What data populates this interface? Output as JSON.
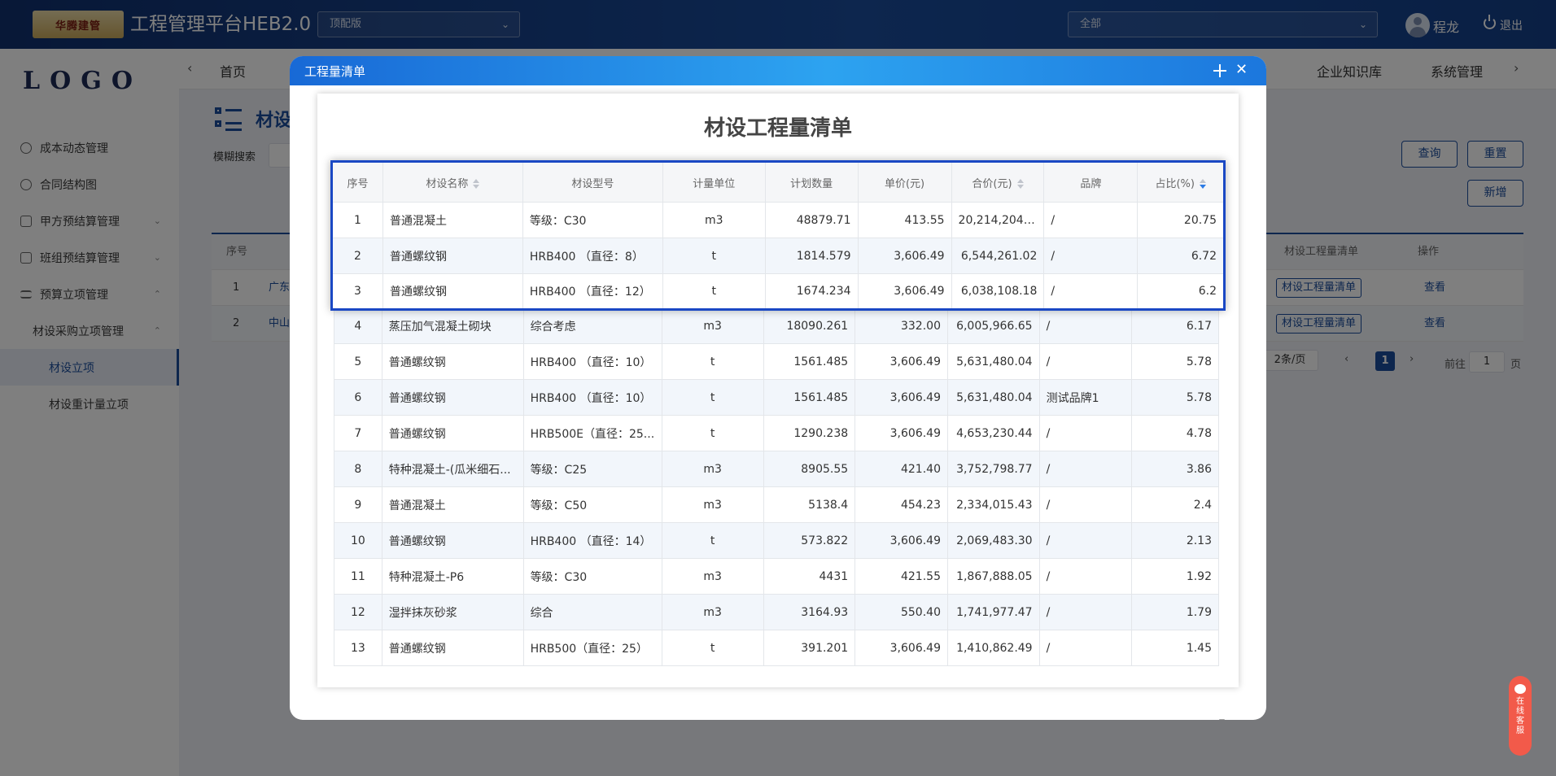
{
  "header": {
    "brand_logo_text": "华腾建管",
    "app_title": "工程管理平台HEB2.0",
    "version_select": "顶配版",
    "scope_select": "全部",
    "user_name": "程龙",
    "logout_label": "退出"
  },
  "sidebar": {
    "logo": "LOGO",
    "items": [
      {
        "label": "成本动态管理"
      },
      {
        "label": "合同结构图"
      },
      {
        "label": "甲方预结算管理"
      },
      {
        "label": "班组预结算管理"
      },
      {
        "label": "预算立项管理"
      },
      {
        "label": "材设采购立项管理"
      },
      {
        "label": "材设立项"
      },
      {
        "label": "材设重计量立项"
      }
    ]
  },
  "nav": {
    "tabs": [
      {
        "label": "首页"
      },
      {
        "label": "企业知识库"
      },
      {
        "label": "系统管理"
      }
    ]
  },
  "main": {
    "page_title": "材设",
    "fuzzy_search_label": "模糊搜索",
    "buttons": {
      "query": "查询",
      "reset": "重置",
      "add": "新增"
    },
    "table": {
      "headers": {
        "index": "序号",
        "bill": "材设工程量清单",
        "action": "操作"
      },
      "rows": [
        {
          "index": "1",
          "name": "广东",
          "bill": "材设工程量清单",
          "action": "查看"
        },
        {
          "index": "2",
          "name": "中山",
          "bill": "材设工程量清单",
          "action": "查看"
        }
      ]
    },
    "pager": {
      "page_size": "2条/页",
      "current": "1",
      "goto_prefix": "前往",
      "goto_value": "1",
      "goto_suffix": "页"
    }
  },
  "dialog": {
    "title": "工程量清单",
    "sheet_title": "材设工程量清单",
    "columns": [
      "序号",
      "材设名称",
      "材设型号",
      "计量单位",
      "计划数量",
      "单价(元)",
      "合价(元)",
      "品牌",
      "占比(%)"
    ],
    "rows": [
      {
        "no": "1",
        "name": "普通混凝土",
        "model": "等级：C30",
        "unit": "m3",
        "qty": "48879.71",
        "price": "413.55",
        "total": "20,214,204....",
        "brand": "/",
        "ratio": "20.75"
      },
      {
        "no": "2",
        "name": "普通螺纹钢",
        "model": "HRB400 （直径：8）",
        "unit": "t",
        "qty": "1814.579",
        "price": "3,606.49",
        "total": "6,544,261.02",
        "brand": "/",
        "ratio": "6.72"
      },
      {
        "no": "3",
        "name": "普通螺纹钢",
        "model": "HRB400 （直径：12）",
        "unit": "t",
        "qty": "1674.234",
        "price": "3,606.49",
        "total": "6,038,108.18",
        "brand": "/",
        "ratio": "6.2"
      },
      {
        "no": "4",
        "name": "蒸压加气混凝土砌块",
        "model": "综合考虑",
        "unit": "m3",
        "qty": "18090.261",
        "price": "332.00",
        "total": "6,005,966.65",
        "brand": "/",
        "ratio": "6.17"
      },
      {
        "no": "5",
        "name": "普通螺纹钢",
        "model": "HRB400 （直径：10）",
        "unit": "t",
        "qty": "1561.485",
        "price": "3,606.49",
        "total": "5,631,480.04",
        "brand": "/",
        "ratio": "5.78"
      },
      {
        "no": "6",
        "name": "普通螺纹钢",
        "model": "HRB400 （直径：10）",
        "unit": "t",
        "qty": "1561.485",
        "price": "3,606.49",
        "total": "5,631,480.04",
        "brand": "测试品牌1",
        "ratio": "5.78"
      },
      {
        "no": "7",
        "name": "普通螺纹钢",
        "model": "HRB500E（直径：25...",
        "unit": "t",
        "qty": "1290.238",
        "price": "3,606.49",
        "total": "4,653,230.44",
        "brand": "/",
        "ratio": "4.78"
      },
      {
        "no": "8",
        "name": "特种混凝土-(瓜米细石...",
        "model": "等级：C25",
        "unit": "m3",
        "qty": "8905.55",
        "price": "421.40",
        "total": "3,752,798.77",
        "brand": "/",
        "ratio": "3.86"
      },
      {
        "no": "9",
        "name": "普通混凝土",
        "model": "等级：C50",
        "unit": "m3",
        "qty": "5138.4",
        "price": "454.23",
        "total": "2,334,015.43",
        "brand": "/",
        "ratio": "2.4"
      },
      {
        "no": "10",
        "name": "普通螺纹钢",
        "model": "HRB400 （直径：14）",
        "unit": "t",
        "qty": "573.822",
        "price": "3,606.49",
        "total": "2,069,483.30",
        "brand": "/",
        "ratio": "2.13"
      },
      {
        "no": "11",
        "name": "特种混凝土-P6",
        "model": "等级：C30",
        "unit": "m3",
        "qty": "4431",
        "price": "421.55",
        "total": "1,867,888.05",
        "brand": "/",
        "ratio": "1.92"
      },
      {
        "no": "12",
        "name": "湿拌抹灰砂浆",
        "model": "综合",
        "unit": "m3",
        "qty": "3164.93",
        "price": "550.40",
        "total": "1,741,977.47",
        "brand": "/",
        "ratio": "1.79"
      },
      {
        "no": "13",
        "name": "普通螺纹钢",
        "model": "HRB500（直径：25）",
        "unit": "t",
        "qty": "391.201",
        "price": "3,606.49",
        "total": "1,410,862.49",
        "brand": "/",
        "ratio": "1.45"
      }
    ]
  },
  "service": {
    "label": "在线客服"
  },
  "colors": {
    "primary": "#1a4c9c",
    "dialog_header": "#2da3f0",
    "highlight_border": "#1a48c4",
    "service": "#f25a4a"
  }
}
